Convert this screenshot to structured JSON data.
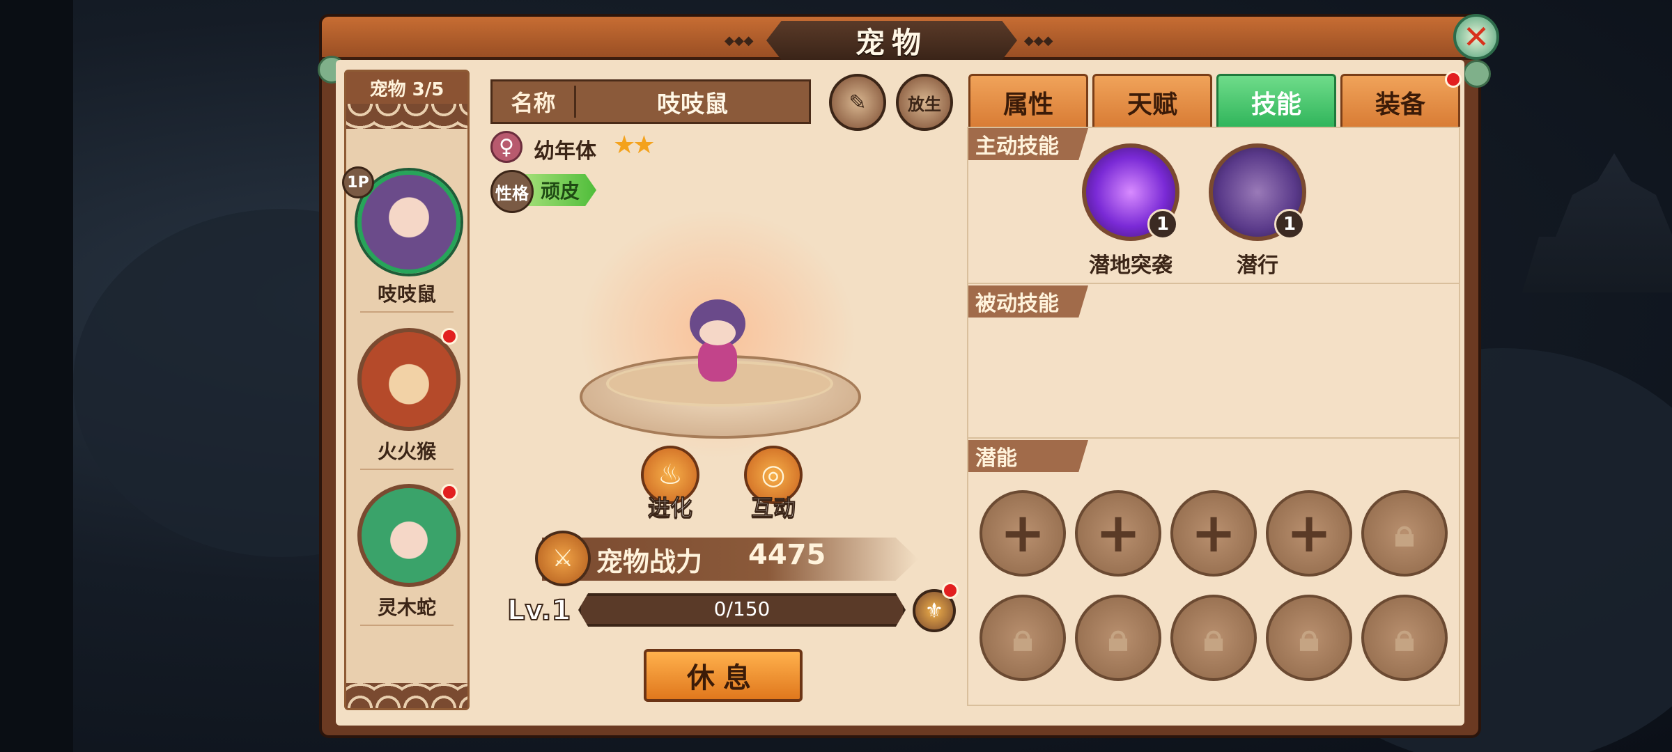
{
  "window": {
    "title": "宠物"
  },
  "sidebar": {
    "header": "宠物 3/5",
    "pets": [
      {
        "name": "吱吱鼠",
        "badge": "1P",
        "selected": true,
        "has_notice": false,
        "avatar_color": "#6b4b8a"
      },
      {
        "name": "火火猴",
        "badge": "",
        "selected": false,
        "has_notice": true,
        "avatar_color": "#b54a2a"
      },
      {
        "name": "灵木蛇",
        "badge": "",
        "selected": false,
        "has_notice": true,
        "avatar_color": "#3aa36a"
      }
    ]
  },
  "detail": {
    "name_label": "名称",
    "name_value": "吱吱鼠",
    "action_icons": [
      "scroll-pen-icon",
      "release-icon"
    ],
    "release_label": "放生",
    "gender": "♀",
    "stage": "幼年体",
    "stars": 2,
    "trait_badge": "性格",
    "trait_value": "顽皮",
    "actions": [
      {
        "label": "进化",
        "icon": "flame-icon"
      },
      {
        "label": "互动",
        "icon": "swirl-icon"
      }
    ],
    "power_label": "宠物战力",
    "power_value": "4475",
    "level_text": "Lv.1",
    "xp_text": "0/150",
    "xp_fraction": 0,
    "rest_label": "休息"
  },
  "tabs": [
    {
      "label": "属性",
      "active": false,
      "notice": false
    },
    {
      "label": "天赋",
      "active": false,
      "notice": false
    },
    {
      "label": "技能",
      "active": true,
      "notice": false
    },
    {
      "label": "装备",
      "active": false,
      "notice": true
    }
  ],
  "skills": {
    "active_label": "主动技能",
    "active": [
      {
        "name": "潜地突袭",
        "level": "1",
        "color": "#7a2ad6"
      },
      {
        "name": "潜行",
        "level": "1",
        "color": "#5a3a8a"
      }
    ],
    "passive_label": "被动技能",
    "potential_label": "潜能",
    "potential_slots": [
      "add",
      "add",
      "add",
      "add",
      "locked",
      "locked",
      "locked",
      "locked",
      "locked",
      "locked"
    ]
  },
  "colors": {
    "accent_green": "#2fb45a",
    "accent_orange": "#e0781d",
    "notice_red": "#e21f1f"
  }
}
